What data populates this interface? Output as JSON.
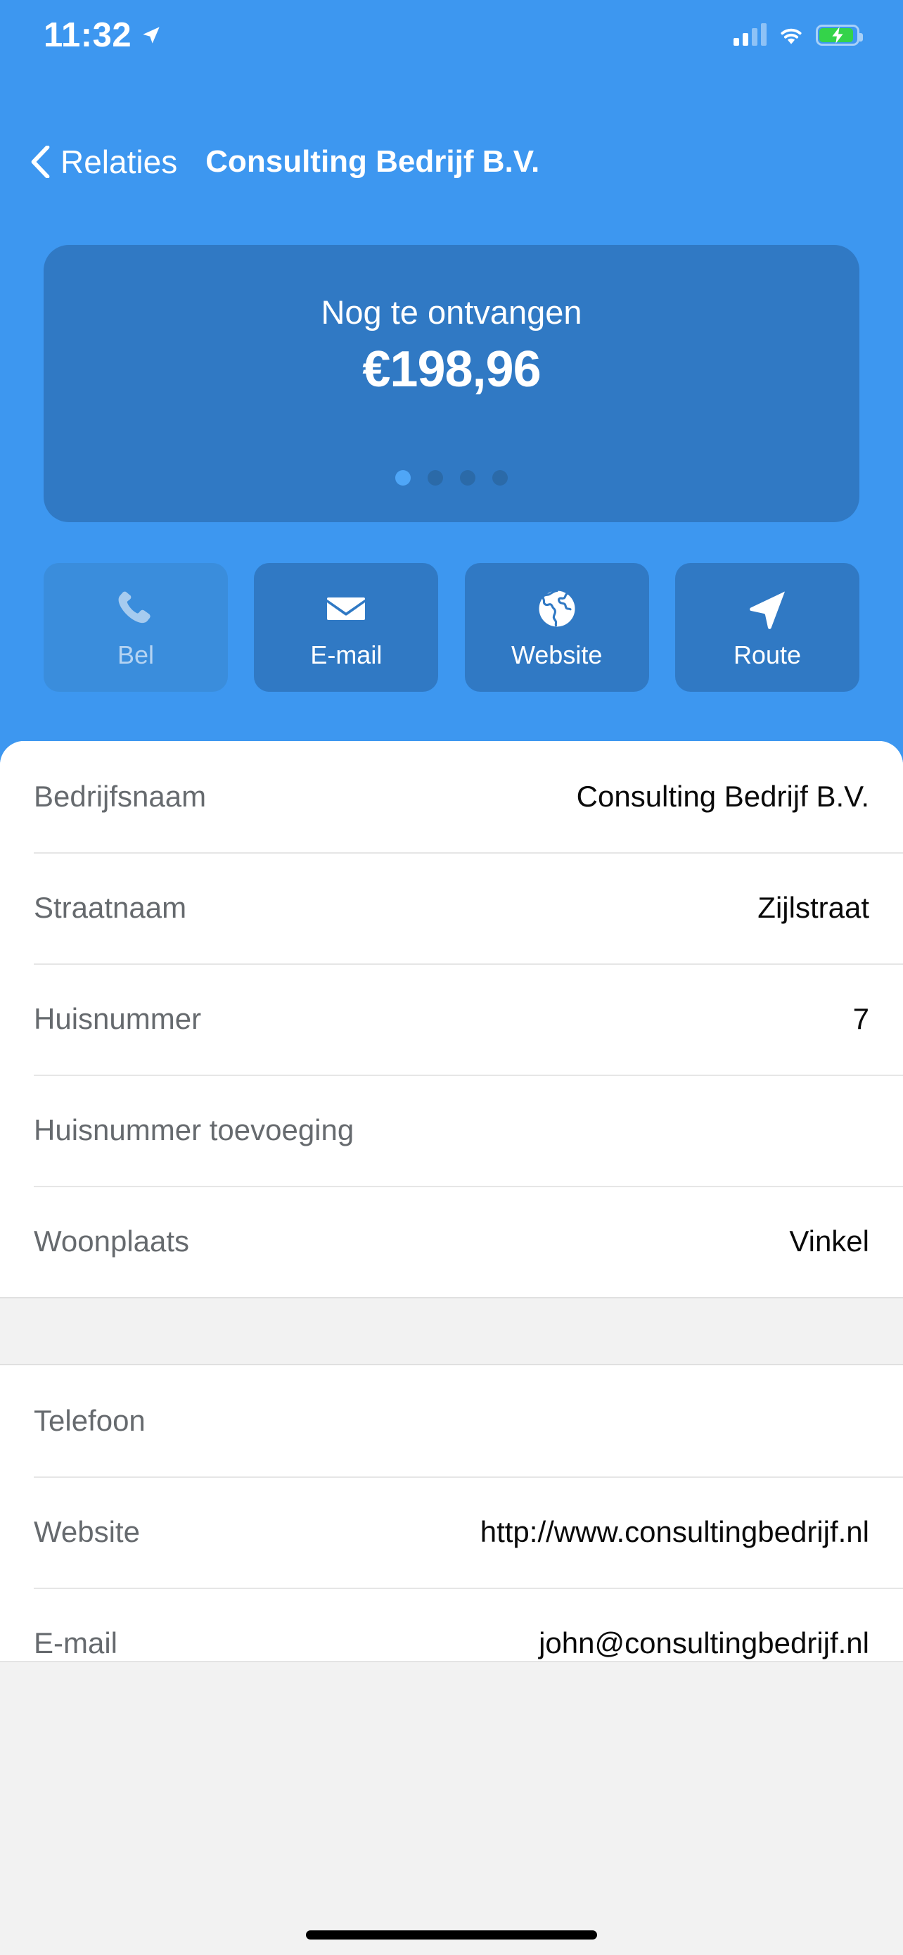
{
  "status_bar": {
    "time": "11:32",
    "location_icon": "location-arrow-icon",
    "signal_icon": "cellular-signal-icon",
    "signal_bars_filled": 2,
    "signal_bars_total": 4,
    "wifi_icon": "wifi-icon",
    "battery_icon": "battery-charging-icon",
    "battery_charging": true
  },
  "nav_bar": {
    "back_icon": "chevron-left-icon",
    "back_label": "Relaties",
    "title": "Consulting Bedrijf B.V."
  },
  "balance_card": {
    "label": "Nog te ontvangen",
    "amount": "€198,96",
    "page_dots_total": 4,
    "page_dot_active_index": 0
  },
  "actions": [
    {
      "label": "Bel",
      "icon": "phone-icon",
      "enabled": false
    },
    {
      "label": "E-mail",
      "icon": "envelope-icon",
      "enabled": true
    },
    {
      "label": "Website",
      "icon": "globe-icon",
      "enabled": true
    },
    {
      "label": "Route",
      "icon": "navigation-arrow-icon",
      "enabled": true
    }
  ],
  "details": {
    "group_1": [
      {
        "label": "Bedrijfsnaam",
        "value": "Consulting Bedrijf B.V."
      },
      {
        "label": "Straatnaam",
        "value": "Zijlstraat"
      },
      {
        "label": "Huisnummer",
        "value": "7"
      },
      {
        "label": "Huisnummer toevoeging",
        "value": ""
      },
      {
        "label": "Woonplaats",
        "value": "Vinkel"
      }
    ],
    "group_2": [
      {
        "label": "Telefoon",
        "value": ""
      },
      {
        "label": "Website",
        "value": "http://www.consultingbedrijf.nl"
      },
      {
        "label": "E-mail",
        "value": "john@consultingbedrijf.nl"
      }
    ]
  },
  "colors": {
    "background_blue": "#3d97f0",
    "card_blue": "#3079c4",
    "accent_dot": "#4fa6f7",
    "battery_green": "#34d34a",
    "panel_white": "#ffffff",
    "group_gap_gray": "#f2f2f2",
    "label_gray": "#666a6e"
  },
  "home_indicator": "home-indicator-bar"
}
